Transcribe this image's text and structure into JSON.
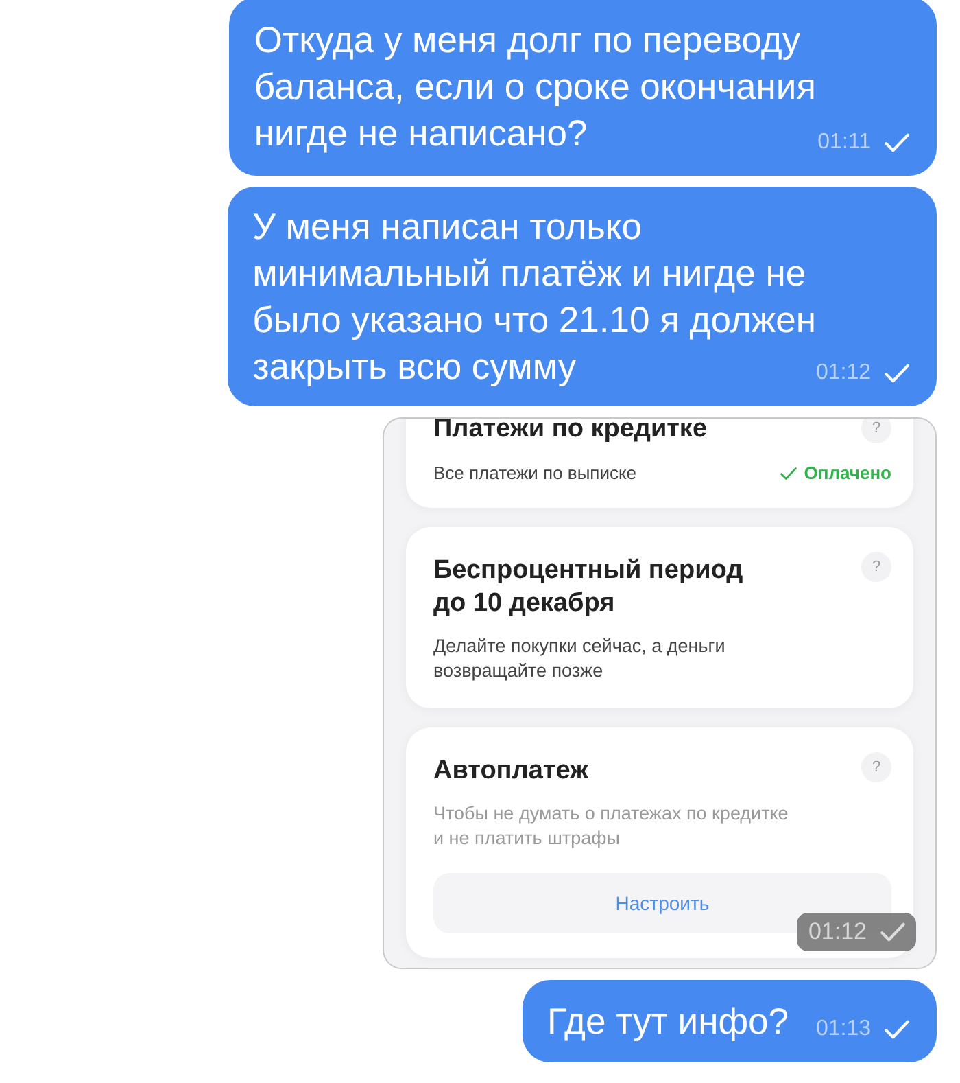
{
  "messages": [
    {
      "kind": "text",
      "text": "Откуда у меня долг по переводу\nбаланса, если о сроке окончания\nнигде не написано?",
      "time": "01:11"
    },
    {
      "kind": "text",
      "text": "У меня написан только\nминимальный платёж и нигде не\nбыло указано что 21.10 я должен\nзакрыть всю сумму",
      "time": "01:12"
    },
    {
      "kind": "image",
      "time": "01:12",
      "cards": [
        {
          "kind": "status",
          "title": "Платежи по кредитке",
          "help": "?",
          "row_label": "Все платежи по выписке",
          "status": "Оплачено"
        },
        {
          "kind": "info",
          "title": "Беспроцентный период\nдо 10 декабря",
          "help": "?",
          "description": "Делайте покупки сейчас, а деньги\nвозвращайте позже"
        },
        {
          "kind": "action",
          "title": "Автоплатеж",
          "help": "?",
          "description": "Чтобы не думать о платежах по кредитке\nи не платить штрафы",
          "button": "Настроить"
        }
      ]
    },
    {
      "kind": "text",
      "text": "Где тут инфо?",
      "time": "01:13"
    }
  ]
}
